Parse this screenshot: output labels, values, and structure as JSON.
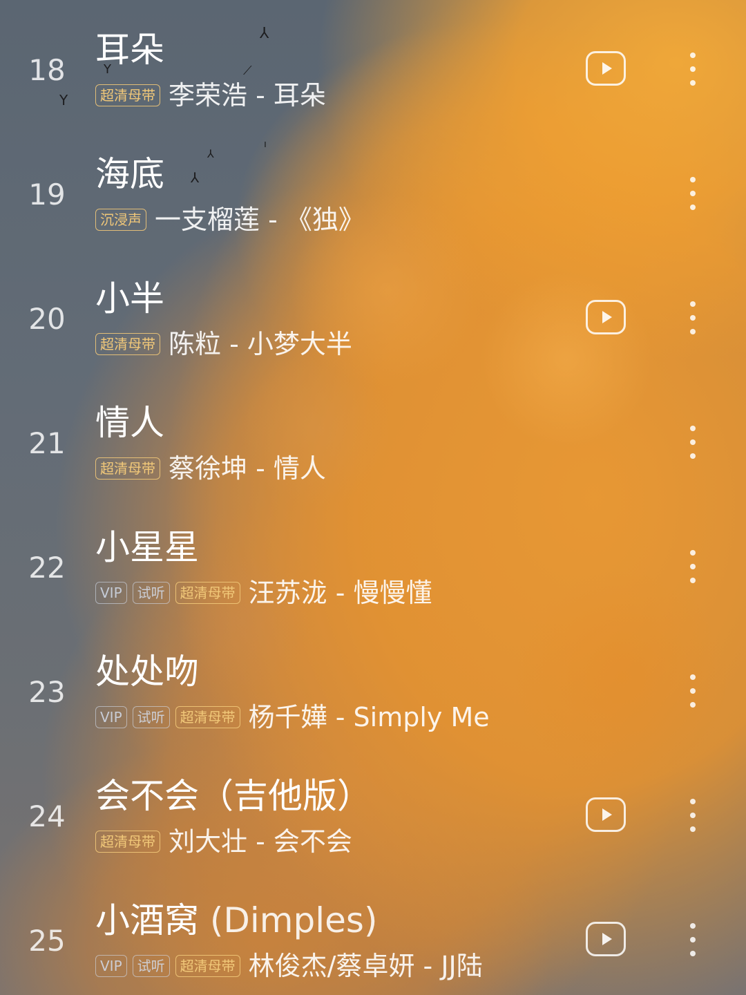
{
  "songs": [
    {
      "index": "18",
      "title": "耳朵",
      "title_suffix": "",
      "tags": [
        {
          "text": "超清母带",
          "style": "gold"
        }
      ],
      "artist_line": "李荣浩 - 耳朵",
      "has_video": true
    },
    {
      "index": "19",
      "title": "海底",
      "title_suffix": "",
      "tags": [
        {
          "text": "沉浸声",
          "style": "gold"
        }
      ],
      "artist_line": "一支榴莲 - 《独》",
      "has_video": false
    },
    {
      "index": "20",
      "title": "小半",
      "title_suffix": "",
      "tags": [
        {
          "text": "超清母带",
          "style": "gold"
        }
      ],
      "artist_line": "陈粒 - 小梦大半",
      "has_video": true
    },
    {
      "index": "21",
      "title": "情人",
      "title_suffix": "",
      "tags": [
        {
          "text": "超清母带",
          "style": "gold"
        }
      ],
      "artist_line": "蔡徐坤 - 情人",
      "has_video": false
    },
    {
      "index": "22",
      "title": "小星星",
      "title_suffix": "",
      "tags": [
        {
          "text": "VIP",
          "style": "vip"
        },
        {
          "text": "试听",
          "style": "vip"
        },
        {
          "text": "超清母带",
          "style": "gold"
        }
      ],
      "artist_line": "汪苏泷 - 慢慢懂",
      "has_video": false
    },
    {
      "index": "23",
      "title": "处处吻",
      "title_suffix": "",
      "tags": [
        {
          "text": "VIP",
          "style": "vip"
        },
        {
          "text": "试听",
          "style": "vip"
        },
        {
          "text": "超清母带",
          "style": "gold"
        }
      ],
      "artist_line": "杨千嬅 - Simply Me",
      "has_video": false
    },
    {
      "index": "24",
      "title": "会不会（吉他版）",
      "title_suffix": "",
      "tags": [
        {
          "text": "超清母带",
          "style": "gold"
        }
      ],
      "artist_line": "刘大壮 - 会不会",
      "has_video": true
    },
    {
      "index": "25",
      "title": "小酒窝",
      "title_suffix": " (Dimples)",
      "tags": [
        {
          "text": "VIP",
          "style": "vip"
        },
        {
          "text": "试听",
          "style": "vip"
        },
        {
          "text": "超清母带",
          "style": "gold"
        }
      ],
      "artist_line": "林俊杰/蔡卓妍 - JJ陆",
      "has_video": true
    }
  ],
  "icons": {
    "play": "play-video-icon",
    "more": "more-vertical-icon"
  },
  "colors": {
    "tag_gold": "#f1c879",
    "sky": "#5d6773",
    "cloud": "#e8982f"
  }
}
